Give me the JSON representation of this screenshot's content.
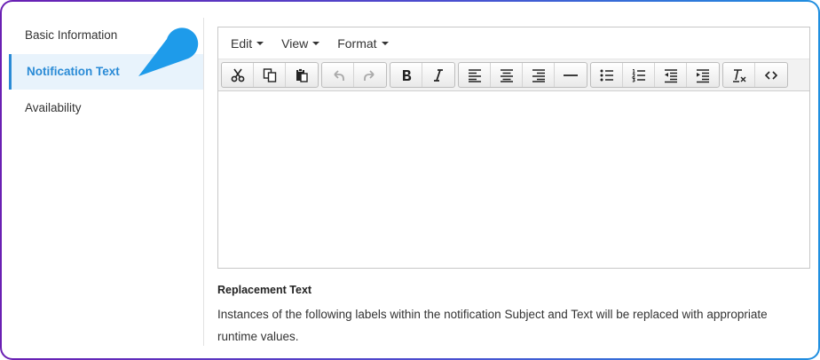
{
  "sidebar": {
    "items": [
      {
        "label": "Basic Information"
      },
      {
        "label": "Notification Text"
      },
      {
        "label": "Availability"
      }
    ]
  },
  "editor": {
    "menu": [
      {
        "label": "Edit"
      },
      {
        "label": "View"
      },
      {
        "label": "Format"
      }
    ],
    "toolbar_icons": [
      "cut-icon",
      "copy-icon",
      "paste-icon",
      "undo-icon",
      "redo-icon",
      "bold-icon",
      "italic-icon",
      "align-left-icon",
      "align-center-icon",
      "align-right-icon",
      "horizontal-rule-icon",
      "bullet-list-icon",
      "numbered-list-icon",
      "outdent-icon",
      "indent-icon",
      "clear-formatting-icon",
      "source-code-icon"
    ],
    "content": ""
  },
  "replacement": {
    "title": "Replacement Text",
    "description": "Instances of the following labels within the notification Subject and Text will be replaced with appropriate runtime values."
  },
  "colors": {
    "accent": "#2a8bd6",
    "pointer": "#1e9bea",
    "frame_start": "#6a1fb3",
    "frame_end": "#1f8fe0"
  }
}
